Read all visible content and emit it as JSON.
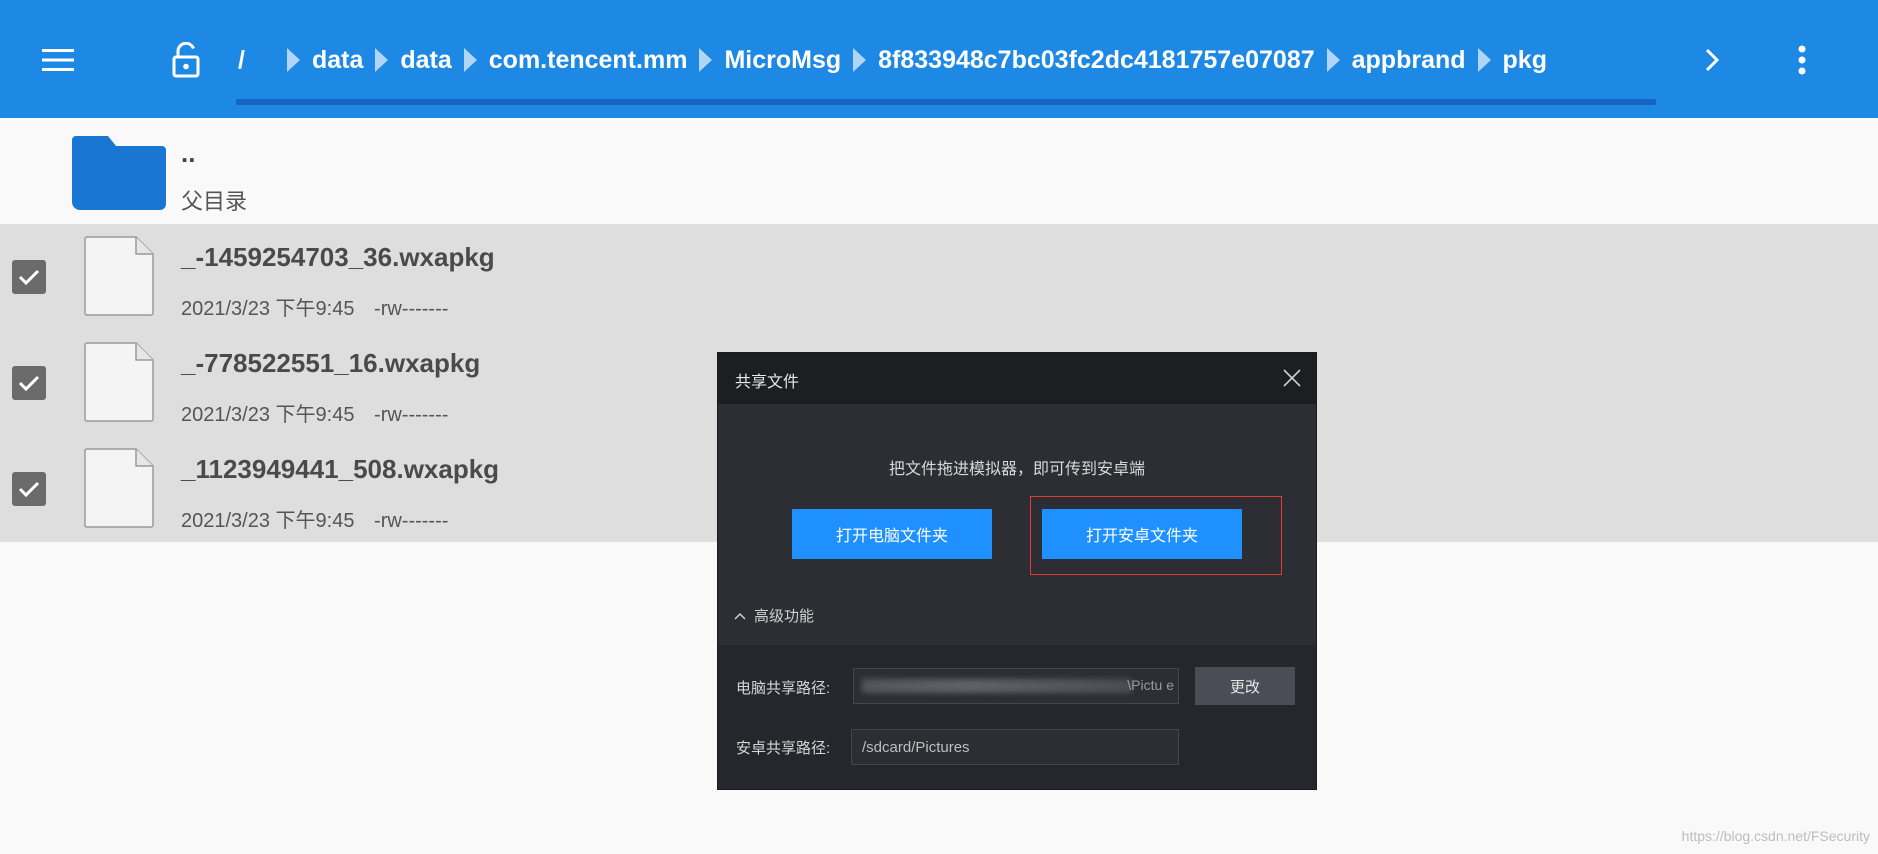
{
  "topbar": {
    "breadcrumbs": {
      "root": "/",
      "items": [
        "data",
        "data",
        "com.tencent.mm",
        "MicroMsg",
        "8f833948c7bc03fc2dc4181757e07087",
        "appbrand",
        "pkg"
      ]
    },
    "icons": {
      "menu": "menu-icon",
      "lock": "unlock-icon",
      "next": "chevron-right-icon",
      "more": "more-vert-icon"
    },
    "colors": {
      "background": "#1e88e5",
      "progress": "#1565c0"
    }
  },
  "list": {
    "parent": {
      "name": "..",
      "subtitle": "父目录"
    },
    "files": [
      {
        "name": "_-1459254703_36.wxapkg",
        "date": "2021/3/23 下午9:45",
        "perm": "-rw-------",
        "checked": true
      },
      {
        "name": "_-778522551_16.wxapkg",
        "date": "2021/3/23 下午9:45",
        "perm": "-rw-------",
        "checked": true
      },
      {
        "name": "_1123949441_508.wxapkg",
        "date": "2021/3/23 下午9:45",
        "perm": "-rw-------",
        "checked": true
      }
    ]
  },
  "dialog": {
    "title": "共享文件",
    "hint": "把文件拖进模拟器，即可传到安卓端",
    "open_pc_folder": "打开电脑文件夹",
    "open_android_folder": "打开安卓文件夹",
    "advanced": "高级功能",
    "pc_path_label": "电脑共享路径:",
    "pc_path_value": "\\Pictu e",
    "android_path_label": "安卓共享路径:",
    "android_path_value": "/sdcard/Pictures",
    "change_button": "更改",
    "colors": {
      "primary": "#1e90ff",
      "highlight": "#e53935"
    }
  },
  "watermark": "https://blog.csdn.net/FSecurity"
}
